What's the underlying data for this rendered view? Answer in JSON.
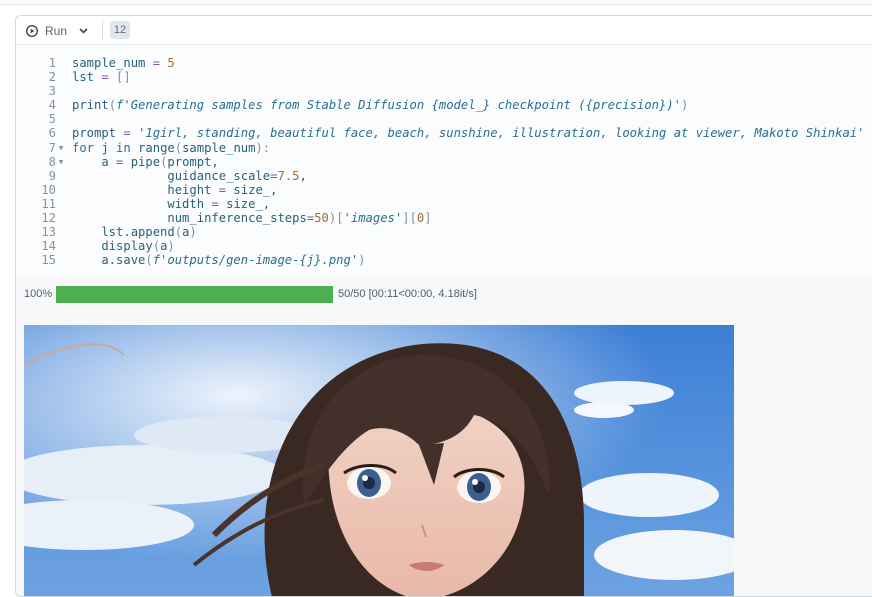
{
  "toolbar": {
    "run_label": "Run",
    "execution_count": "12"
  },
  "code_lines": [
    {
      "n": "1",
      "tokens": [
        [
          "sample_num ",
          ""
        ],
        [
          "=",
          "op"
        ],
        [
          " ",
          ""
        ],
        [
          "5",
          "num"
        ]
      ]
    },
    {
      "n": "2",
      "tokens": [
        [
          "lst ",
          ""
        ],
        [
          "=",
          "op"
        ],
        [
          " ",
          ""
        ],
        [
          "[]",
          "brk"
        ]
      ]
    },
    {
      "n": "3",
      "tokens": []
    },
    {
      "n": "4",
      "tokens": [
        [
          "print",
          ""
        ],
        [
          "(",
          "brk"
        ],
        [
          "f'Generating samples from Stable Diffusion {model_} checkpoint ({precision})'",
          "str"
        ],
        [
          ")",
          "brk"
        ]
      ]
    },
    {
      "n": "5",
      "tokens": []
    },
    {
      "n": "6",
      "tokens": [
        [
          "prompt ",
          ""
        ],
        [
          "=",
          "op"
        ],
        [
          " ",
          ""
        ],
        [
          "'1girl, standing, beautiful face, beach, sunshine, illustration, looking at viewer, Makoto Shinkai'",
          "str"
        ]
      ]
    },
    {
      "n": "7",
      "fold": true,
      "tokens": [
        [
          "for",
          "kw"
        ],
        [
          " j ",
          ""
        ],
        [
          "in",
          "kw"
        ],
        [
          " range",
          ""
        ],
        [
          "(",
          "brk"
        ],
        [
          "sample_num",
          ""
        ],
        [
          "):",
          "brk"
        ]
      ]
    },
    {
      "n": "8",
      "fold": true,
      "tokens": [
        [
          "    a ",
          ""
        ],
        [
          "=",
          "op"
        ],
        [
          " pipe",
          ""
        ],
        [
          "(",
          "brk"
        ],
        [
          "prompt,",
          ""
        ]
      ]
    },
    {
      "n": "9",
      "tokens": [
        [
          "             guidance_scale",
          ""
        ],
        [
          "=",
          "op"
        ],
        [
          "7.5",
          "num"
        ],
        [
          ",",
          ""
        ]
      ]
    },
    {
      "n": "10",
      "tokens": [
        [
          "             height ",
          ""
        ],
        [
          "=",
          "op"
        ],
        [
          " size_,",
          ""
        ]
      ]
    },
    {
      "n": "11",
      "tokens": [
        [
          "             width ",
          ""
        ],
        [
          "=",
          "op"
        ],
        [
          " size_,",
          ""
        ]
      ]
    },
    {
      "n": "12",
      "tokens": [
        [
          "             num_inference_steps",
          ""
        ],
        [
          "=",
          "op"
        ],
        [
          "50",
          "num"
        ],
        [
          ")",
          "brk"
        ],
        [
          "[",
          "brk"
        ],
        [
          "'images'",
          "str"
        ],
        [
          "]",
          "brk"
        ],
        [
          "[",
          "brk"
        ],
        [
          "0",
          "num"
        ],
        [
          "]",
          "brk"
        ]
      ]
    },
    {
      "n": "13",
      "tokens": [
        [
          "    lst.append",
          ""
        ],
        [
          "(",
          "brk"
        ],
        [
          "a",
          ""
        ],
        [
          ")",
          "brk"
        ]
      ]
    },
    {
      "n": "14",
      "tokens": [
        [
          "    display",
          ""
        ],
        [
          "(",
          "brk"
        ],
        [
          "a",
          ""
        ],
        [
          ")",
          "brk"
        ]
      ]
    },
    {
      "n": "15",
      "tokens": [
        [
          "    a.save",
          ""
        ],
        [
          "(",
          "brk"
        ],
        [
          "f'outputs/gen-image-{j}.png'",
          "str"
        ],
        [
          ")",
          "brk"
        ]
      ]
    }
  ],
  "output": {
    "progress_percent_label": "100%",
    "progress_fraction": 1.0,
    "progress_stats": "50/50 [00:11<00:00, 4.18it/s]"
  },
  "colors": {
    "progress_fill": "#4caf50",
    "code_text": "#27627a",
    "string": "#2a6f8e",
    "number": "#a86a2d"
  }
}
